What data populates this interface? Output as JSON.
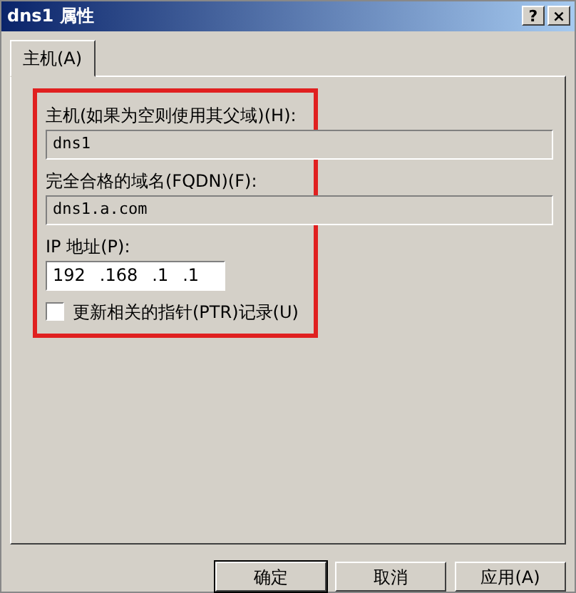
{
  "window": {
    "title": "dns1 属性",
    "buttons": [
      "?",
      "×"
    ]
  },
  "tabs": [
    {
      "label": "主机(A)",
      "selected": true
    }
  ],
  "form": {
    "host": {
      "label": "主机(如果为空则使用其父域)(H):",
      "value": "dns1"
    },
    "fqdn": {
      "label": "完全合格的域名(FQDN)(F):",
      "value": "dns1.a.com"
    },
    "ip": {
      "label": "IP 地址(P):",
      "segments": [
        "192",
        ".168",
        ".1",
        ".1"
      ]
    },
    "ptr": {
      "label": "更新相关的指针(PTR)记录(U)",
      "checked": false
    }
  },
  "buttons": [
    "确定",
    "取消",
    "应用(A)"
  ]
}
